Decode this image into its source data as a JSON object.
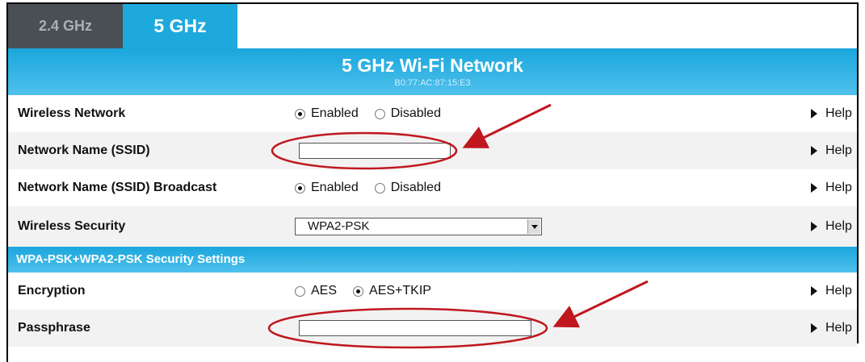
{
  "tabs": [
    {
      "label": "2.4 GHz",
      "active": false
    },
    {
      "label": "5 GHz",
      "active": true
    }
  ],
  "header": {
    "title": "5 GHz Wi-Fi Network",
    "mac": "B0:77:AC:87:15:E3"
  },
  "rows": {
    "wireless_network": {
      "label": "Wireless Network",
      "opt1": "Enabled",
      "opt2": "Disabled",
      "selected": "Enabled"
    },
    "ssid": {
      "label": "Network Name (SSID)",
      "value": ""
    },
    "broadcast": {
      "label": "Network Name (SSID) Broadcast",
      "opt1": "Enabled",
      "opt2": "Disabled",
      "selected": "Enabled"
    },
    "security": {
      "label": "Wireless Security",
      "value": "WPA2-PSK"
    },
    "encryption": {
      "label": "Encryption",
      "opt1": "AES",
      "opt2": "AES+TKIP",
      "selected": "AES+TKIP"
    },
    "passphrase": {
      "label": "Passphrase",
      "value": ""
    }
  },
  "section": {
    "title": "WPA-PSK+WPA2-PSK Security Settings"
  },
  "help_label": "Help",
  "colors": {
    "accent": "#1ea9dd",
    "tab_inactive": "#4a4f55",
    "annotation": "#c0171f"
  }
}
